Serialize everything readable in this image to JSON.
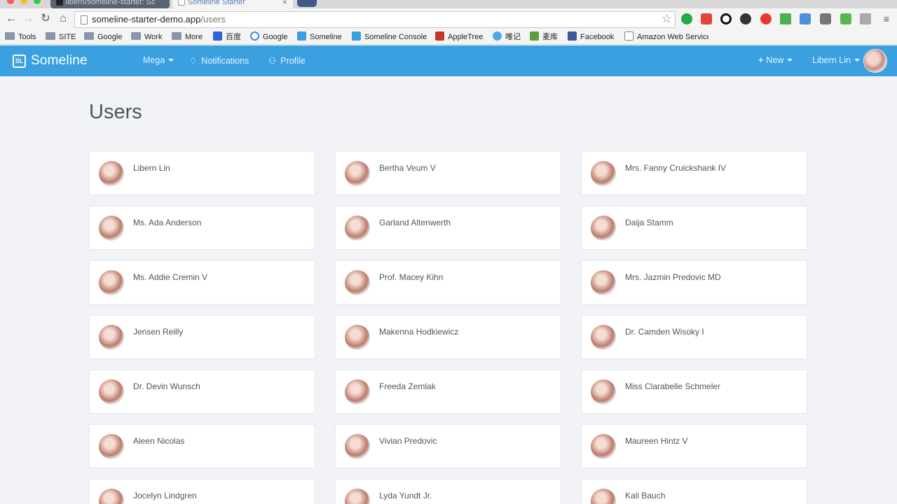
{
  "browser": {
    "tabs": [
      {
        "title": "libern/someline-starter: Sc",
        "active": false
      },
      {
        "title": "Someline Starter",
        "active": true
      }
    ],
    "url_host": "someline-starter-demo.app",
    "url_path": "/users",
    "bookmarks": [
      {
        "label": "Tools",
        "icon": "folder-icon"
      },
      {
        "label": "SITE",
        "icon": "folder-icon"
      },
      {
        "label": "Google",
        "icon": "folder-icon"
      },
      {
        "label": "Work",
        "icon": "folder-icon"
      },
      {
        "label": "More",
        "icon": "folder-icon"
      },
      {
        "label": "百度",
        "icon": "baidu-icon"
      },
      {
        "label": "Google",
        "icon": "google-icon"
      },
      {
        "label": "Someline",
        "icon": "someline-icon"
      },
      {
        "label": "Someline Console",
        "icon": "someline-icon"
      },
      {
        "label": "AppleTree",
        "icon": "appletree-icon"
      },
      {
        "label": "唯记",
        "icon": "heart-icon"
      },
      {
        "label": "麦库",
        "icon": "maiku-icon"
      },
      {
        "label": "Facebook",
        "icon": "facebook-icon"
      },
      {
        "label": "Amazon Web Service",
        "icon": "page-icon"
      }
    ]
  },
  "app": {
    "logo_mark": "SL",
    "logo_text": "Someline",
    "nav": {
      "mega": "Mega",
      "notifications": "Notifications",
      "profile": "Profile",
      "new": "New",
      "user": "Libern Lin"
    },
    "brand_color": "#3aa0e0"
  },
  "page": {
    "title": "Users"
  },
  "users": [
    "Libern Lin",
    "Bertha Veum V",
    "Mrs. Fanny Cruickshank IV",
    "Ms. Ada Anderson",
    "Garland Altenwerth",
    "Daija Stamm",
    "Ms. Addie Cremin V",
    "Prof. Macey Kihn",
    "Mrs. Jazmin Predovic MD",
    "Jensen Reilly",
    "Makenna Hodkiewicz",
    "Dr. Camden Wisoky I",
    "Dr. Devin Wunsch",
    "Freeda Zemlak",
    "Miss Clarabelle Schmeler",
    "Aleen Nicolas",
    "Vivian Predovic",
    "Maureen Hintz V",
    "Jocelyn Lindgren",
    "Lyda Yundt Jr.",
    "Kali Bauch"
  ]
}
